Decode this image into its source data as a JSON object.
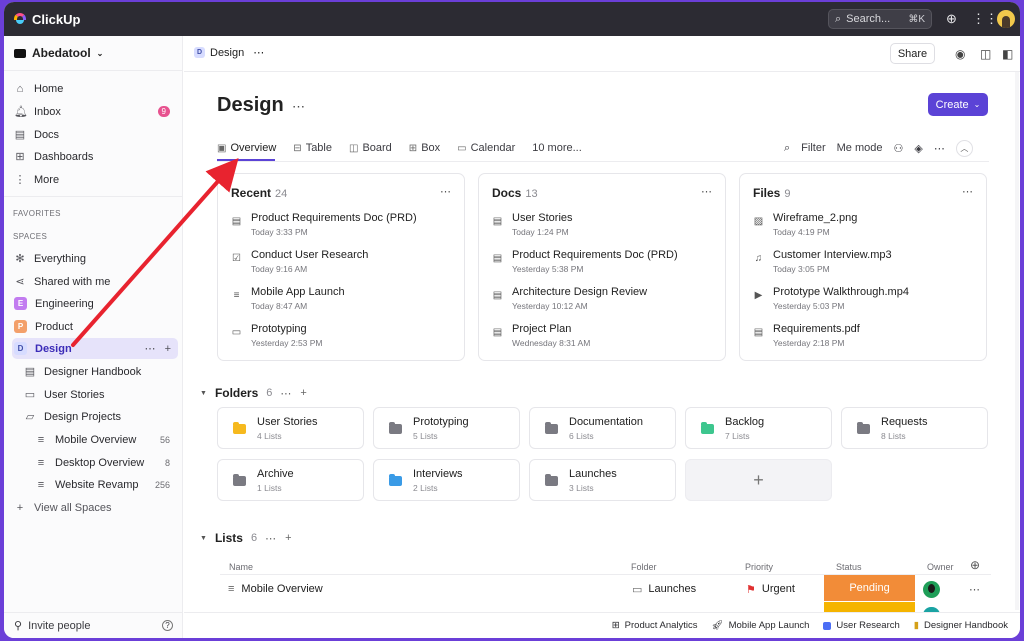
{
  "app": {
    "name": "ClickUp",
    "search_label": "Search...",
    "search_shortcut": "⌘K"
  },
  "sidebar": {
    "workspace": "Abedatool",
    "nav": [
      {
        "label": "Home",
        "icon": "home-icon"
      },
      {
        "label": "Inbox",
        "icon": "bell-icon",
        "badge": "9"
      },
      {
        "label": "Docs",
        "icon": "doc-icon"
      },
      {
        "label": "Dashboards",
        "icon": "dashboard-icon"
      },
      {
        "label": "More",
        "icon": "more-vertical-icon"
      }
    ],
    "favorites_label": "FAVORITES",
    "spaces_label": "SPACES",
    "spaces": [
      {
        "label": "Everything",
        "icon": "asterisk-icon"
      },
      {
        "label": "Shared with me",
        "icon": "share-icon"
      },
      {
        "label": "Engineering",
        "letter": "E",
        "color": "#c27cf0"
      },
      {
        "label": "Product",
        "letter": "P",
        "color": "#f3a06a"
      },
      {
        "label": "Design",
        "letter": "D",
        "color": "#d7dcff"
      }
    ],
    "design_children": [
      {
        "label": "Designer Handbook",
        "icon": "doc-icon"
      },
      {
        "label": "User Stories",
        "icon": "folder-icon"
      },
      {
        "label": "Design Projects",
        "icon": "folder-open-icon"
      }
    ],
    "project_lists": [
      {
        "label": "Mobile Overview",
        "count": "56"
      },
      {
        "label": "Desktop Overview",
        "count": "8"
      },
      {
        "label": "Website Revamp",
        "count": "256"
      }
    ],
    "view_all": "View all Spaces",
    "invite": "Invite people"
  },
  "header": {
    "breadcrumb": "Design",
    "share": "Share"
  },
  "page": {
    "title": "Design",
    "create": "Create",
    "tabs": [
      {
        "label": "Overview",
        "icon": "overview-icon"
      },
      {
        "label": "Table",
        "icon": "table-icon"
      },
      {
        "label": "Board",
        "icon": "board-icon"
      },
      {
        "label": "Box",
        "icon": "box-icon"
      },
      {
        "label": "Calendar",
        "icon": "calendar-icon"
      },
      {
        "label": "10 more..."
      }
    ],
    "tools": {
      "filter": "Filter",
      "me_mode": "Me mode"
    }
  },
  "cards": [
    {
      "title": "Recent",
      "count": "24",
      "items": [
        {
          "title": "Product Requirements Doc (PRD)",
          "sub": "Today 3:33 PM",
          "icon": "doc-icon"
        },
        {
          "title": "Conduct User Research",
          "sub": "Today 9:16 AM",
          "icon": "checkbox-icon"
        },
        {
          "title": "Mobile App Launch",
          "sub": "Today 8:47 AM",
          "icon": "list-icon"
        },
        {
          "title": "Prototyping",
          "sub": "Yesterday 2:53 PM",
          "icon": "folder-icon"
        }
      ]
    },
    {
      "title": "Docs",
      "count": "13",
      "items": [
        {
          "title": "User Stories",
          "sub": "Today 1:24 PM",
          "icon": "doc-icon"
        },
        {
          "title": "Product Requirements Doc (PRD)",
          "sub": "Yesterday 5:38 PM",
          "icon": "doc-icon"
        },
        {
          "title": "Architecture Design Review",
          "sub": "Yesterday 10:12 AM",
          "icon": "doc-icon"
        },
        {
          "title": "Project Plan",
          "sub": "Wednesday 8:31 AM",
          "icon": "doc-icon"
        }
      ]
    },
    {
      "title": "Files",
      "count": "9",
      "items": [
        {
          "title": "Wireframe_2.png",
          "sub": "Today 4:19 PM",
          "icon": "image-icon"
        },
        {
          "title": "Customer Interview.mp3",
          "sub": "Today 3:05 PM",
          "icon": "audio-icon"
        },
        {
          "title": "Prototype Walkthrough.mp4",
          "sub": "Yesterday 5:03 PM",
          "icon": "video-icon"
        },
        {
          "title": "Requirements.pdf",
          "sub": "Yesterday 2:18 PM",
          "icon": "doc-icon"
        }
      ]
    }
  ],
  "folders_section": {
    "title": "Folders",
    "count": "6"
  },
  "folders": [
    {
      "name": "User Stories",
      "sub": "4 Lists",
      "color": "#f6b91e"
    },
    {
      "name": "Prototyping",
      "sub": "5 Lists",
      "color": "#7a7a82"
    },
    {
      "name": "Documentation",
      "sub": "6 Lists",
      "color": "#7a7a82"
    },
    {
      "name": "Backlog",
      "sub": "7 Lists",
      "color": "#3dc68e"
    },
    {
      "name": "Requests",
      "sub": "8 Lists",
      "color": "#7a7a82"
    },
    {
      "name": "Archive",
      "sub": "1 Lists",
      "color": "#7a7a82"
    },
    {
      "name": "Interviews",
      "sub": "2 Lists",
      "color": "#3a9be6"
    },
    {
      "name": "Launches",
      "sub": "3 Lists",
      "color": "#7a7a82"
    }
  ],
  "lists_section": {
    "title": "Lists",
    "count": "6"
  },
  "list_table": {
    "headers": {
      "name": "Name",
      "folder": "Folder",
      "priority": "Priority",
      "status": "Status",
      "owner": "Owner"
    },
    "row": {
      "name": "Mobile Overview",
      "folder": "Launches",
      "priority": "Urgent",
      "status": "Pending"
    }
  },
  "bottom_tabs": [
    {
      "label": "Product Analytics",
      "icon": "dashboard-icon"
    },
    {
      "label": "Mobile App Launch",
      "icon": "rocket-icon"
    },
    {
      "label": "User Research",
      "icon": "square-icon",
      "color": "#4c6ef5"
    },
    {
      "label": "Designer Handbook",
      "icon": "book-icon"
    }
  ]
}
